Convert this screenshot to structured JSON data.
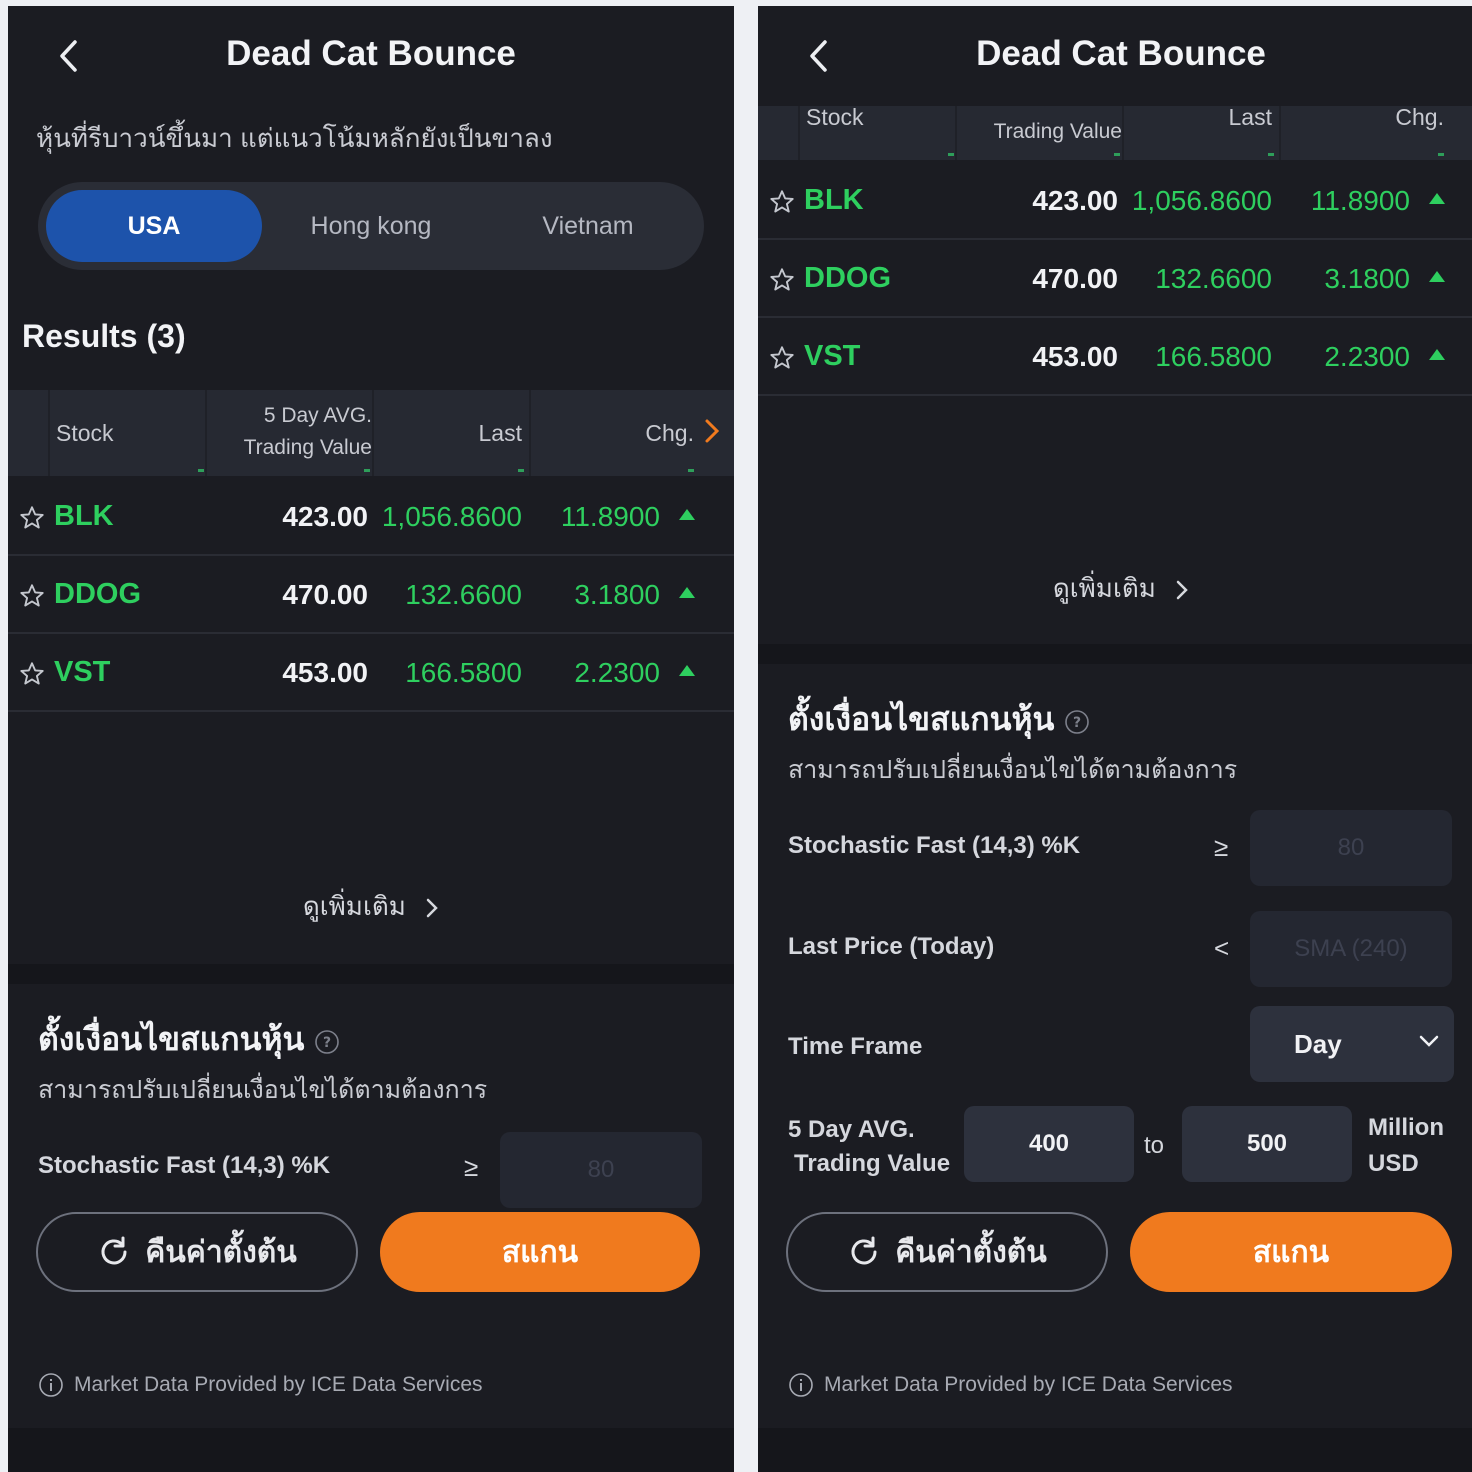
{
  "header": {
    "title": "Dead Cat Bounce"
  },
  "subtitle": "หุ้นที่รีบาวน์ขึ้นมา แต่แนวโน้มหลักยังเป็นขาลง",
  "tabs": [
    {
      "label": "USA",
      "active": true
    },
    {
      "label": "Hong kong",
      "active": false
    },
    {
      "label": "Vietnam",
      "active": false
    }
  ],
  "results_label": "Results (3)",
  "table": {
    "headers": {
      "stock": "Stock",
      "avg_line1": "5 Day AVG.",
      "avg_line2": "Trading Value",
      "last": "Last",
      "chg": "Chg."
    },
    "rows": [
      {
        "symbol": "BLK",
        "last": "423.00",
        "avg": "1,056.8600",
        "chg": "11.8900"
      },
      {
        "symbol": "DDOG",
        "last": "470.00",
        "avg": "132.6600",
        "chg": "3.1800"
      },
      {
        "symbol": "VST",
        "last": "453.00",
        "avg": "166.5800",
        "chg": "2.2300"
      }
    ]
  },
  "see_more": "ดูเพิ่มเติม",
  "conditions": {
    "title": "ตั้งเงื่อนไขสแกนหุ้น",
    "subtitle": "สามารถปรับเปลี่ยนเงื่อนไขได้ตามต้องการ",
    "stochastic": {
      "label": "Stochastic Fast (14,3) %K",
      "op": "≥",
      "placeholder": "80"
    },
    "last_price": {
      "label": "Last Price (Today)",
      "op": "<",
      "placeholder": "SMA (240)"
    },
    "time_frame": {
      "label": "Time Frame",
      "value": "Day"
    },
    "trading_value": {
      "label_line1": "5 Day AVG.",
      "label_line2": "Trading Value",
      "from": "400",
      "to_label": "to",
      "to": "500",
      "unit_line1": "Million",
      "unit_line2": "USD"
    }
  },
  "buttons": {
    "reset": "คืนค่าตั้งต้น",
    "scan": "สแกน"
  },
  "footer": "Market Data Provided by ICE Data Services",
  "colors": {
    "accent": "#f07a1e",
    "positive": "#2ecf5f",
    "tab_active": "#1d53ab",
    "background": "#1b1c22"
  }
}
